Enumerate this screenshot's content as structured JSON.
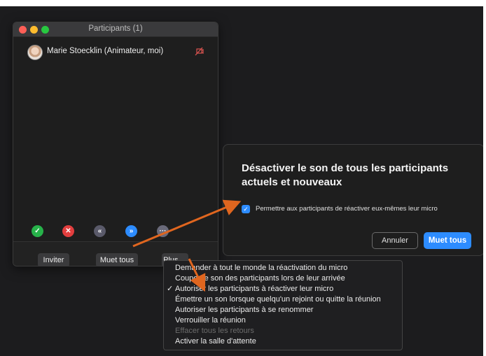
{
  "window": {
    "title": "Participants (1)"
  },
  "participants": [
    {
      "name": "Marie Stoecklin (Animateur, moi)",
      "avatar": "user-avatar",
      "mic_icon": "mic-off-icon"
    }
  ],
  "reactions": [
    {
      "name": "yes-icon",
      "glyph": "✓",
      "color": "#27b24a"
    },
    {
      "name": "no-icon",
      "glyph": "✕",
      "color": "#e23e3e"
    },
    {
      "name": "go-slower-icon",
      "glyph": "«",
      "color": "#5a5a6a"
    },
    {
      "name": "go-faster-icon",
      "glyph": "»",
      "color": "#2d8cff"
    },
    {
      "name": "more-icon",
      "glyph": "···",
      "color": "#6a6a7a"
    }
  ],
  "toolbar": {
    "invite_label": "Inviter",
    "mute_all_label": "Muet tous",
    "more_label": "Plus"
  },
  "dialog": {
    "title": "Désactiver le son de tous les participants actuels et nouveaux",
    "checkbox_label": "Permettre aux participants de réactiver eux-mêmes leur micro",
    "checkbox_checked": true,
    "cancel_label": "Annuler",
    "confirm_label": "Muet tous"
  },
  "more_menu": {
    "items": [
      {
        "label": "Demander à tout le monde la réactivation du micro",
        "checked": false,
        "disabled": false
      },
      {
        "label": "Couper le son des participants lors de leur arrivée",
        "checked": false,
        "disabled": false
      },
      {
        "label": "Autoriser les participants à réactiver leur micro",
        "checked": true,
        "disabled": false
      },
      {
        "label": "Émettre un son lorsque quelqu'un rejoint ou quitte la réunion",
        "checked": false,
        "disabled": false
      },
      {
        "label": "Autoriser les participants à se renommer",
        "checked": false,
        "disabled": false
      },
      {
        "label": "Verrouiller la réunion",
        "checked": false,
        "disabled": false
      },
      {
        "label": "Effacer tous les retours",
        "checked": false,
        "disabled": true
      },
      {
        "label": "Activer la salle d'attente",
        "checked": false,
        "disabled": false
      }
    ]
  },
  "colors": {
    "accent": "#2d8cff",
    "annotation_arrow": "#e0661f",
    "mic_off": "#d9534f"
  }
}
